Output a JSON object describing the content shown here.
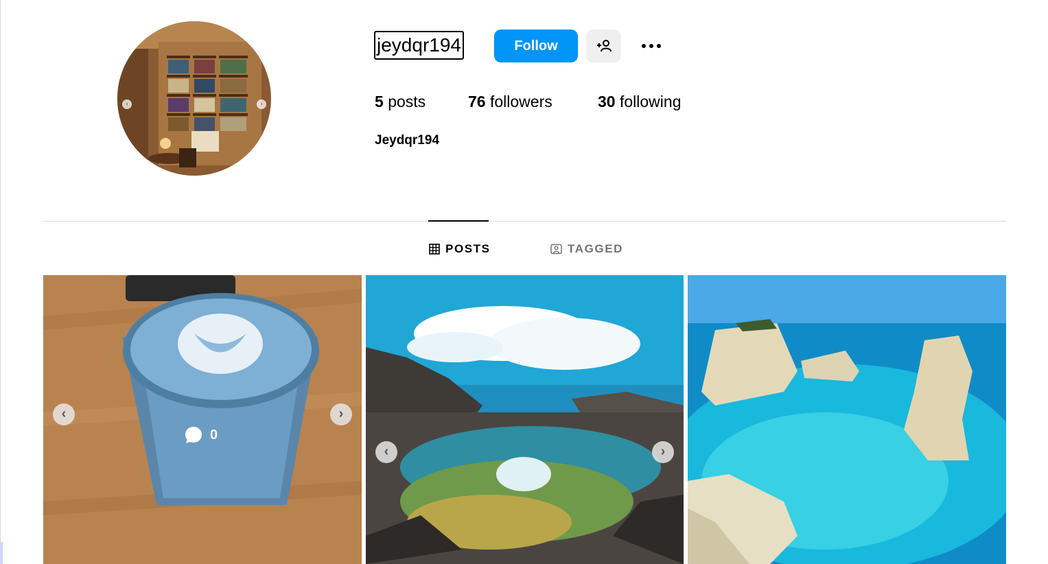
{
  "profile": {
    "username": "jeydqr194",
    "full_name": "Jeydqr194",
    "follow_label": "Follow",
    "stats": {
      "posts_count": "5",
      "posts_label": "posts",
      "followers_count": "76",
      "followers_label": "followers",
      "following_count": "30",
      "following_label": "following"
    },
    "avatar_icon": "bookshelf-photo"
  },
  "tabs": [
    {
      "label": "POSTS",
      "icon": "grid-icon",
      "active": true
    },
    {
      "label": "TAGGED",
      "icon": "tagged-icon",
      "active": false
    }
  ],
  "posts": [
    {
      "subject": "blue latte",
      "comments": "0",
      "has_carousel": true
    },
    {
      "subject": "rock pool swimmer",
      "has_carousel": true
    },
    {
      "subject": "sea stacks turquoise water",
      "has_carousel": false
    }
  ],
  "colors": {
    "accent": "#0095f6",
    "secondary_button": "#efefef",
    "divider": "#dbdbdb",
    "muted_text": "#737373"
  }
}
